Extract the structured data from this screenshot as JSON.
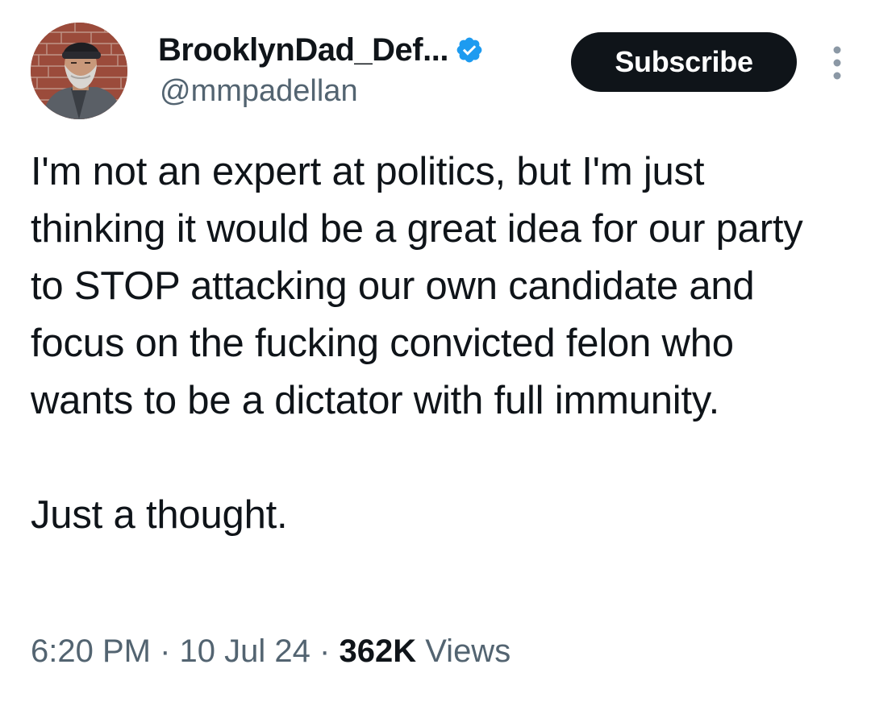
{
  "author": {
    "display_name": "BrooklynDad_Def...",
    "handle": "@mmpadellan",
    "verified_icon": "verified-badge-icon",
    "verified_color": "#1d9bf0"
  },
  "actions": {
    "subscribe_label": "Subscribe",
    "more_icon": "more-vertical-icon"
  },
  "tweet": {
    "paragraphs": [
      "I'm not an expert at politics, but I'm just thinking it would be a great idea for our party to STOP attacking our own candidate and focus on the fucking convicted felon who wants to be a dictator with full immunity.",
      "Just a thought."
    ]
  },
  "meta": {
    "time": "6:20 PM",
    "separator": "·",
    "date": "10 Jul 24",
    "views_count": "362K",
    "views_label": "Views"
  },
  "colors": {
    "text_primary": "#0f1419",
    "text_secondary": "#536471",
    "button_bg": "#0f1419"
  }
}
